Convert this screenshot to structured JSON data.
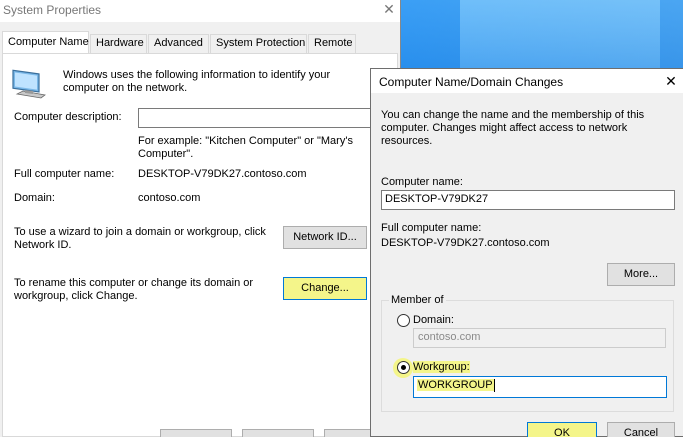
{
  "system_properties": {
    "title": "System Properties",
    "tabs": [
      {
        "label": "Computer Name",
        "active": true
      },
      {
        "label": "Hardware"
      },
      {
        "label": "Advanced"
      },
      {
        "label": "System Protection"
      },
      {
        "label": "Remote"
      }
    ],
    "intro": "Windows uses the following information to identify your computer on the network.",
    "description_label": "Computer description:",
    "description_value": "",
    "example_text": "For example: \"Kitchen Computer\" or \"Mary's Computer\".",
    "full_name_label": "Full computer name:",
    "full_name_value": "DESKTOP-V79DK27.contoso.com",
    "domain_label": "Domain:",
    "domain_value": "contoso.com",
    "network_id_text": "To use a wizard to join a domain or workgroup, click Network ID.",
    "network_id_button": "Network ID...",
    "rename_text": "To rename this computer or change its domain or workgroup, click Change.",
    "change_button": "Change..."
  },
  "dialog": {
    "title": "Computer Name/Domain Changes",
    "intro": "You can change the name and the membership of this computer. Changes might affect access to network resources.",
    "computer_name_label": "Computer name:",
    "computer_name_value": "DESKTOP-V79DK27",
    "full_name_label": "Full computer name:",
    "full_name_value": "DESKTOP-V79DK27.contoso.com",
    "more_button": "More...",
    "member_of_label": "Member of",
    "domain_radio_label": "Domain:",
    "domain_value": "contoso.com",
    "workgroup_radio_label": "Workgroup:",
    "workgroup_value": "WORKGROUP",
    "selected_membership": "workgroup",
    "ok_button": "OK",
    "cancel_button": "Cancel"
  },
  "highlight_color": "#f4f58a",
  "accent_color": "#0078d7"
}
